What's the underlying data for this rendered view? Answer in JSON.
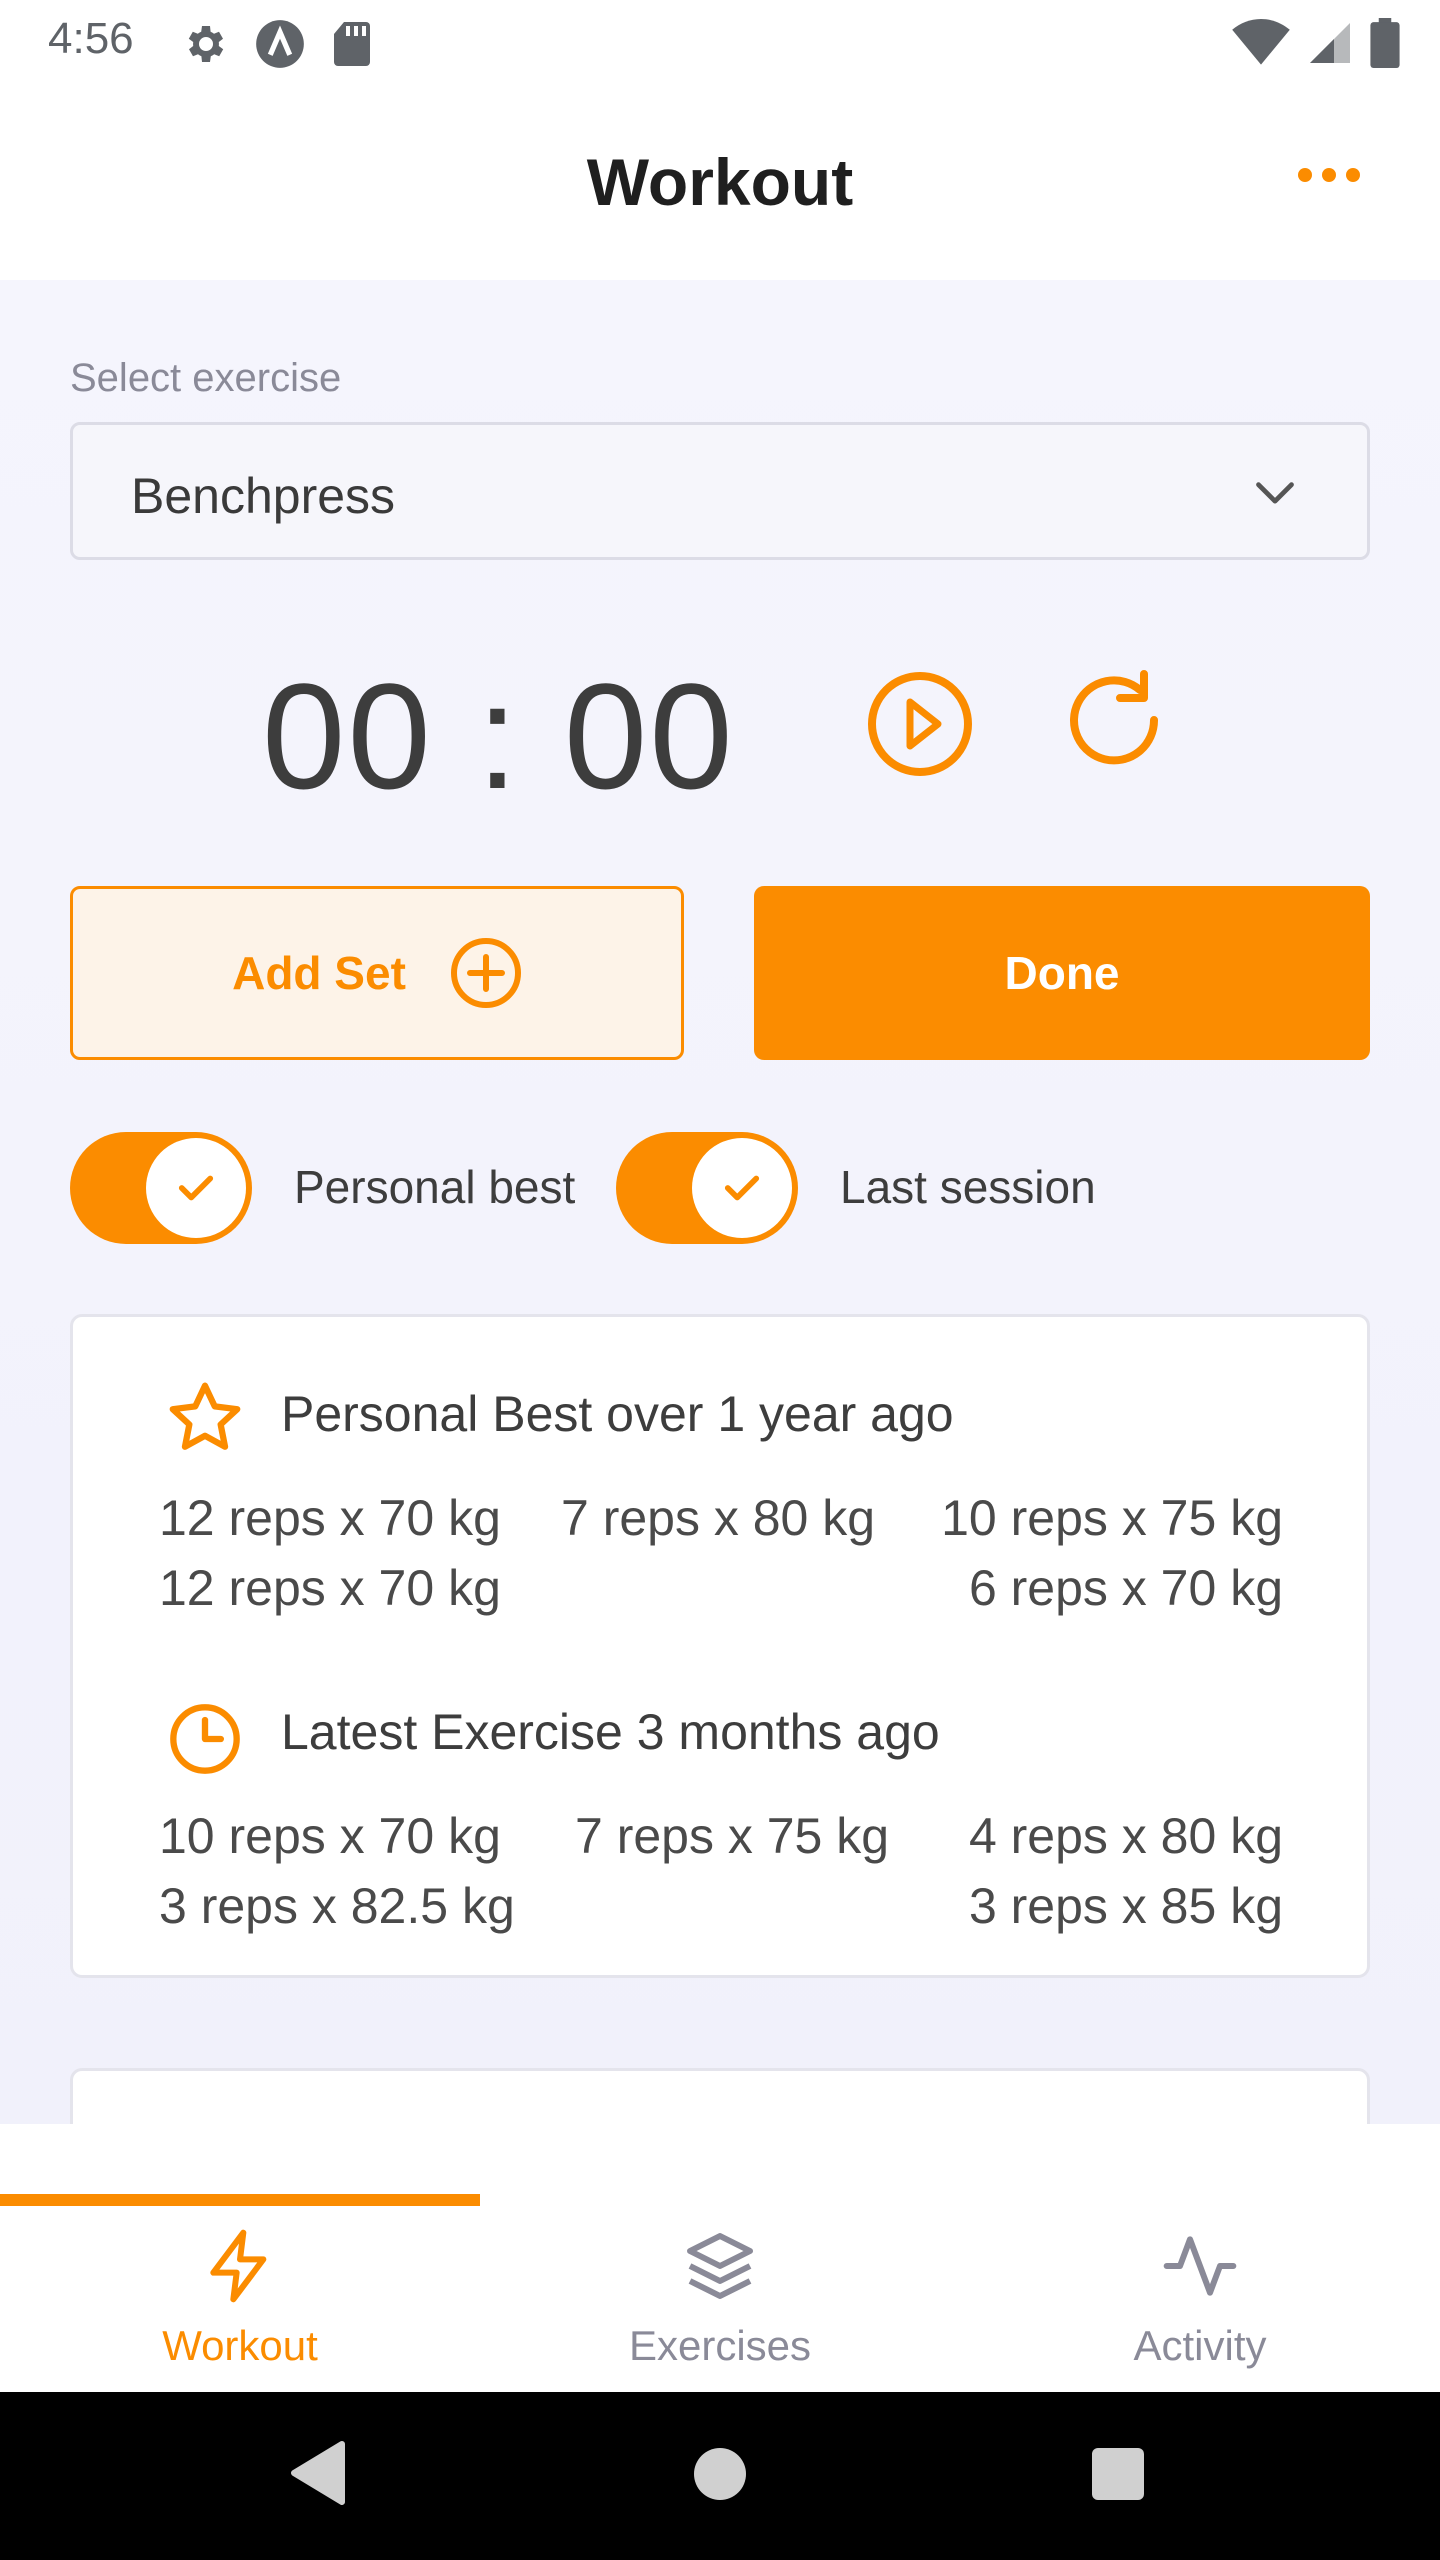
{
  "status_bar": {
    "time": "4:56",
    "left_icons": [
      "settings-gear-icon",
      "a-badge-icon",
      "sd-card-icon"
    ],
    "right_icons": [
      "wifi-icon",
      "signal-icon",
      "battery-icon"
    ]
  },
  "app_bar": {
    "title": "Workout",
    "menu_icon": "more-dots-icon"
  },
  "exercise_select": {
    "label": "Select exercise",
    "value": "Benchpress"
  },
  "timer": {
    "display": "00 : 00"
  },
  "actions": {
    "add_set_label": "Add Set",
    "done_label": "Done"
  },
  "toggles": [
    {
      "label": "Personal best",
      "on": true
    },
    {
      "label": "Last session",
      "on": true
    }
  ],
  "history_card": {
    "personal_best": {
      "heading": "Personal Best over 1 year ago",
      "icon": "star-icon",
      "row1": [
        "12 reps x 70 kg",
        "7 reps x 80 kg",
        "10 reps x 75 kg"
      ],
      "row2": [
        "12 reps x 70 kg",
        "6 reps x 70 kg"
      ]
    },
    "latest": {
      "heading": "Latest Exercise 3 months ago",
      "icon": "clock-icon",
      "row1": [
        "10 reps x 70 kg",
        "7 reps x 75 kg",
        "4 reps x 80 kg"
      ],
      "row2": [
        "3 reps x 82.5 kg",
        "3 reps x 85 kg"
      ]
    }
  },
  "bottom_nav": {
    "items": [
      {
        "label": "Workout",
        "icon": "lightning-icon",
        "active": true
      },
      {
        "label": "Exercises",
        "icon": "layers-icon",
        "active": false
      },
      {
        "label": "Activity",
        "icon": "activity-pulse-icon",
        "active": false
      }
    ]
  },
  "colors": {
    "accent": "#fb8c00",
    "accent_light": "#fdf3e8",
    "background": "#f5f5fd",
    "text_dark": "#1f1f1f",
    "text_muted": "#8a8a98"
  }
}
